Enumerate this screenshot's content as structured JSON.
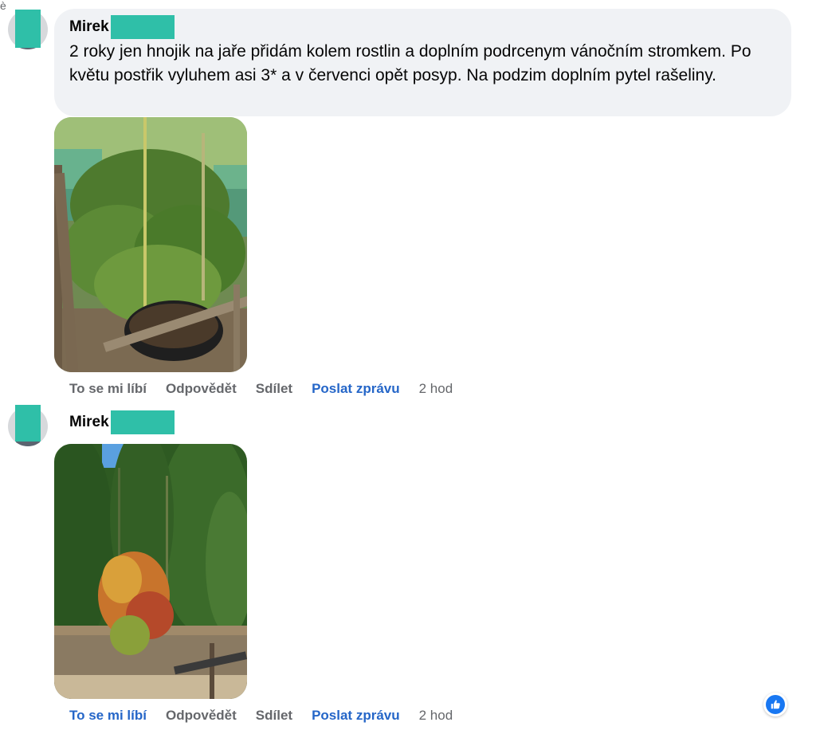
{
  "top_glyph": "è",
  "comments": [
    {
      "author": "Mirek",
      "text": "2 roky jen hnojik na jaře přidám kolem rostlin a doplním podrcenym vánočním stromkem. Po květu postřik vyluhem asi 3* a v červenci opět posyp. Na podzim doplním pytel rašeliny.",
      "photo_description": "",
      "actions": {
        "like": "To se mi líbí",
        "reply": "Odpovědět",
        "share": "Sdílet",
        "message": "Poslat zprávu",
        "time": "2 hod"
      }
    },
    {
      "author": "Mirek",
      "photo_description": "",
      "actions": {
        "like": "To se mi líbí",
        "reply": "Odpovědět",
        "share": "Sdílet",
        "message": "Poslat zprávu",
        "time": "2 hod"
      }
    }
  ],
  "colors": {
    "bubble_bg": "#f0f2f5",
    "redaction": "#2fbfa8",
    "link_blue": "#2566c8",
    "meta_gray": "#65676b",
    "reaction_blue": "#1877f2"
  },
  "reaction_icon": "thumbs-up-icon"
}
